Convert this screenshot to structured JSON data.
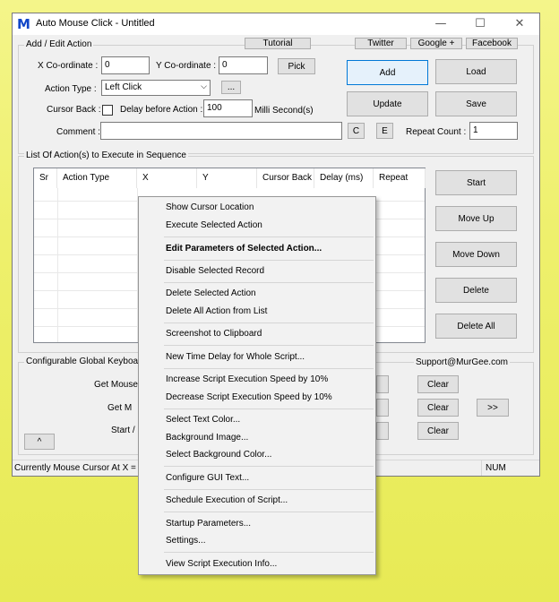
{
  "window": {
    "title": "Auto Mouse Click - Untitled",
    "icon_glyph": "M",
    "minimize_glyph": "—",
    "maximize_glyph": "☐",
    "close_glyph": "✕"
  },
  "add_edit": {
    "group_label": "Add / Edit Action",
    "tutorial_label": "Tutorial",
    "twitter_label": "Twitter",
    "google_label": "Google +",
    "facebook_label": "Facebook",
    "x_label": "X Co-ordinate :",
    "x_value": "0",
    "y_label": "Y Co-ordinate :",
    "y_value": "0",
    "pick_label": "Pick",
    "action_type_label": "Action Type :",
    "action_type_value": "Left Click",
    "ellipsis_label": "...",
    "cursor_back_label": "Cursor Back :",
    "delay_label": "Delay before Action :",
    "delay_value": "100",
    "delay_unit": "Milli Second(s)",
    "comment_label": "Comment :",
    "comment_value": "",
    "c_label": "C",
    "e_label": "E",
    "repeat_label": "Repeat Count :",
    "repeat_value": "1",
    "add_label": "Add",
    "load_label": "Load",
    "update_label": "Update",
    "save_label": "Save"
  },
  "list": {
    "group_label": "List Of Action(s) to Execute in Sequence",
    "columns": [
      "Sr",
      "Action Type",
      "X",
      "Y",
      "Cursor Back",
      "Delay (ms)",
      "Repeat"
    ],
    "start_label": "Start",
    "move_up_label": "Move Up",
    "move_down_label": "Move Down",
    "delete_label": "Delete",
    "delete_all_label": "Delete All"
  },
  "shortcuts": {
    "group_label": "Configurable Global Keyboard",
    "support_label": "Support@MurGee.com",
    "row1_label": "Get Mouse",
    "row2_label": "Get M",
    "row3_label": "Start / S",
    "clear_label": "Clear",
    "more_label": ">>",
    "up_label": "^"
  },
  "status": {
    "text": "Currently Mouse Cursor At X =",
    "num": "NUM"
  },
  "context_menu": {
    "show_cursor": "Show Cursor Location",
    "execute_selected": "Execute Selected Action",
    "edit_params": "Edit Parameters of Selected Action...",
    "disable_record": "Disable Selected Record",
    "delete_selected": "Delete Selected Action",
    "delete_all": "Delete All Action from List",
    "screenshot": "Screenshot to Clipboard",
    "new_delay": "New Time Delay for Whole Script...",
    "increase_speed": "Increase Script Execution Speed by 10%",
    "decrease_speed": "Decrease Script Execution Speed by 10%",
    "text_color": "Select Text Color...",
    "bg_image": "Background Image...",
    "bg_color": "Select Background Color...",
    "gui_text": "Configure GUI Text...",
    "schedule": "Schedule Execution of Script...",
    "startup": "Startup Parameters...",
    "settings": "Settings...",
    "exec_info": "View Script Execution Info..."
  }
}
